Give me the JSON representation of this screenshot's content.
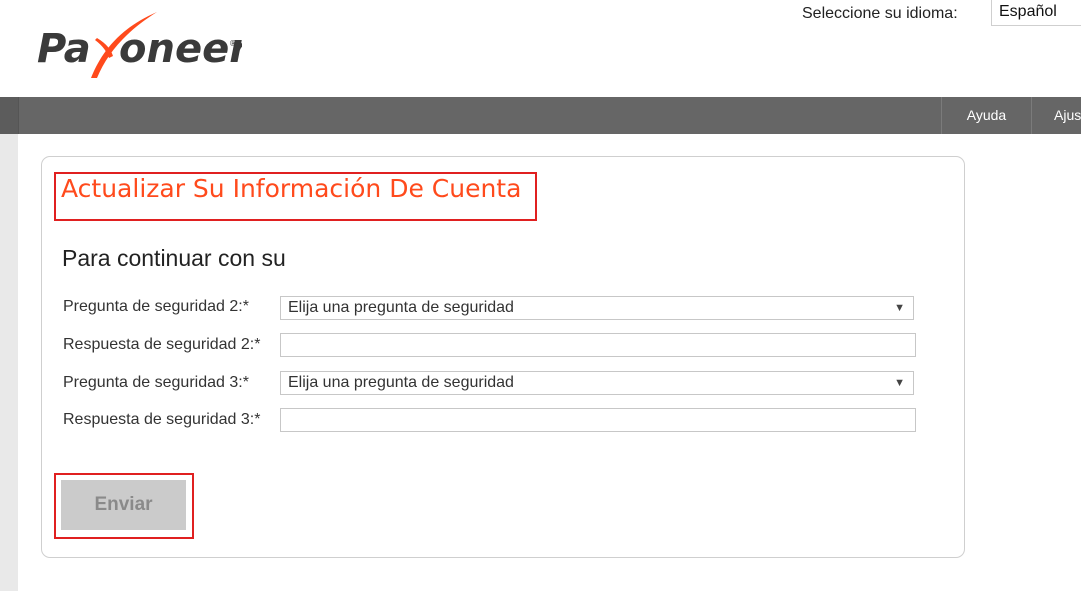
{
  "brand": {
    "logo_text": "Payoneer",
    "accent": "#ff4a1c"
  },
  "language": {
    "label": "Seleccione su idioma:",
    "selected": "Español"
  },
  "nav": {
    "items": [
      {
        "label": "Ayuda"
      },
      {
        "label": "Ajus"
      }
    ]
  },
  "form": {
    "title": "Actualizar Su Información De Cuenta",
    "subtitle": "Para continuar con su",
    "fields": [
      {
        "label": "Pregunta de seguridad 2:*",
        "value": "Elija una pregunta de seguridad"
      },
      {
        "label": "Respuesta de seguridad 2:*",
        "value": ""
      },
      {
        "label": "Pregunta de seguridad 3:*",
        "value": "Elija una pregunta de seguridad"
      },
      {
        "label": "Respuesta de seguridad 3:*",
        "value": ""
      }
    ],
    "submit_label": "Enviar"
  },
  "icons": {
    "dropdown": "triangle-down-icon"
  }
}
